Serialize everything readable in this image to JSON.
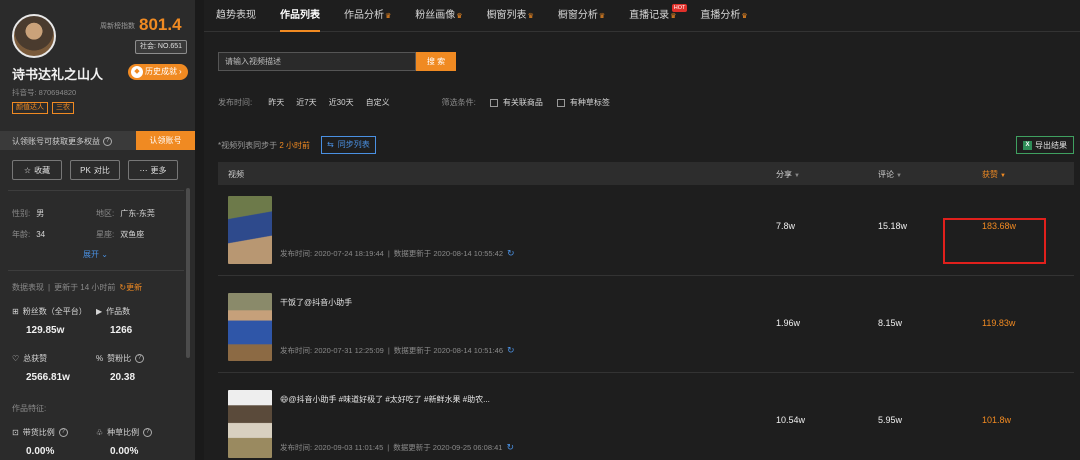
{
  "profile": {
    "index_label": "周新榜指数",
    "index_value": "801.4",
    "social_rank": "社会: NO.651",
    "name": "诗书达礼之山人",
    "history_button": "历史成就",
    "douyin_id": "抖音号: 870694820",
    "tags": [
      "颜值达人",
      "三农"
    ]
  },
  "claim": {
    "text": "认领账号可获取更多权益",
    "button": "认领账号"
  },
  "actions": [
    "收藏",
    "对比",
    "更多"
  ],
  "info": {
    "gender_k": "性别:",
    "gender_v": "男",
    "region_k": "地区:",
    "region_v": "广东-东莞",
    "age_k": "年龄:",
    "age_v": "34",
    "zodiac_k": "星座:",
    "zodiac_v": "双鱼座",
    "expand": "展开"
  },
  "data_perf": {
    "label": "数据表现",
    "updated": "更新于 14 小时前",
    "refresh": "更新"
  },
  "stats": {
    "fans_label": "粉丝数（全平台）",
    "fans_value": "129.85w",
    "works_label": "作品数",
    "works_value": "1266",
    "likes_label": "总获赞",
    "likes_value": "2566.81w",
    "ratio_label": "赞粉比",
    "ratio_value": "20.38",
    "feature_label": "作品特征:",
    "goods_label": "带货比例",
    "goods_value": "0.00%",
    "seed_label": "种草比例",
    "seed_value": "0.00%"
  },
  "tabs": [
    {
      "label": "趋势表现",
      "crown": false,
      "hot": false,
      "active": false
    },
    {
      "label": "作品列表",
      "crown": false,
      "hot": false,
      "active": true
    },
    {
      "label": "作品分析",
      "crown": true,
      "hot": false,
      "active": false
    },
    {
      "label": "粉丝画像",
      "crown": true,
      "hot": false,
      "active": false
    },
    {
      "label": "橱窗列表",
      "crown": true,
      "hot": false,
      "active": false
    },
    {
      "label": "橱窗分析",
      "crown": true,
      "hot": false,
      "active": false
    },
    {
      "label": "直播记录",
      "crown": true,
      "hot": true,
      "active": false
    },
    {
      "label": "直播分析",
      "crown": true,
      "hot": false,
      "active": false
    }
  ],
  "hot_badge": "HOT",
  "search": {
    "placeholder": "请输入视频描述",
    "button": "搜 索"
  },
  "filters": {
    "time_label": "发布时间:",
    "time_options": [
      "昨天",
      "近7天",
      "近30天",
      "自定义"
    ],
    "cond_label": "筛选条件:",
    "cond_goods": "有关联商品",
    "cond_seed": "有种草标签"
  },
  "sync": {
    "prefix": "*视频列表同步于",
    "hours": "2 小时前",
    "button": "同步列表"
  },
  "export_button": "导出结果",
  "table": {
    "headers": {
      "video": "视频",
      "shares": "分享",
      "comments": "评论",
      "likes": "获赞"
    },
    "rows": [
      {
        "title": "",
        "meta_time": "发布时间: 2020-07-24 18:19:44",
        "meta_update": "数据更新于 2020-08-14 10:55:42",
        "shares": "7.8w",
        "comments": "15.18w",
        "likes": "183.68w"
      },
      {
        "title": "干饭了@抖音小助手",
        "meta_time": "发布时间: 2020-07-31 12:25:09",
        "meta_update": "数据更新于 2020-08-14 10:51:46",
        "shares": "1.96w",
        "comments": "8.15w",
        "likes": "119.83w"
      },
      {
        "title": "😄@抖音小助手 #味道好极了 #太好吃了 #新鲜水果 #助农...",
        "meta_time": "发布时间: 2020-09-03 11:01:45",
        "meta_update": "数据更新于 2020-09-25 06:08:41",
        "shares": "10.54w",
        "comments": "5.95w",
        "likes": "101.8w"
      }
    ]
  },
  "colors": {
    "accent": "#f08a22",
    "link": "#4a90e2",
    "highlight": "#e0201c"
  }
}
